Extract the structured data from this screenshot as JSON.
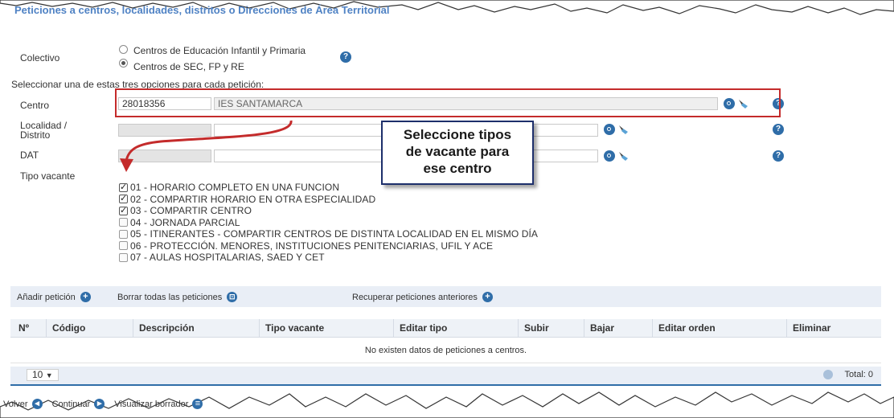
{
  "section": {
    "title": "Peticiones a centros, localidades, distritos o Direcciones de Área Territorial"
  },
  "colectivo": {
    "label": "Colectivo",
    "options": [
      {
        "label": "Centros de Educación Infantil y Primaria",
        "selected": false
      },
      {
        "label": "Centros de SEC, FP y RE",
        "selected": true
      }
    ]
  },
  "instruction": "Seleccionar una de estas tres opciones para cada petición:",
  "centro": {
    "label": "Centro",
    "code": "28018356",
    "name": "IES SANTAMARCA"
  },
  "localidad": {
    "label_line1": "Localidad /",
    "label_line2": "Distrito",
    "code": "",
    "name": ""
  },
  "dat": {
    "label": "DAT",
    "code": "",
    "name": ""
  },
  "callout": {
    "line1": "Seleccione tipos",
    "line2": "de vacante para",
    "line3": "ese centro"
  },
  "tipo_vacante": {
    "label": "Tipo vacante",
    "options": [
      {
        "label": "01 - HORARIO COMPLETO EN UNA FUNCION",
        "checked": true
      },
      {
        "label": "02 - COMPARTIR HORARIO EN OTRA ESPECIALIDAD",
        "checked": true
      },
      {
        "label": "03 - COMPARTIR CENTRO",
        "checked": true
      },
      {
        "label": "04 - JORNADA PARCIAL",
        "checked": false
      },
      {
        "label": "05 - ITINERANTES - COMPARTIR CENTROS DE DISTINTA LOCALIDAD EN EL MISMO DÍA",
        "checked": false
      },
      {
        "label": "06 - PROTECCIÓN. MENORES, INSTITUCIONES PENITENCIARIAS, UFIL Y ACE",
        "checked": false
      },
      {
        "label": "07 - AULAS HOSPITALARIAS, SAED Y CET",
        "checked": false
      }
    ]
  },
  "actions": {
    "add": "Añadir petición",
    "delete_all": "Borrar todas las peticiones",
    "recover": "Recuperar peticiones anteriores"
  },
  "table": {
    "columns": [
      "Nº",
      "Código",
      "Descripción",
      "Tipo vacante",
      "Editar tipo",
      "Subir",
      "Bajar",
      "Editar orden",
      "Eliminar"
    ],
    "empty_message": "No existen datos de peticiones a centros."
  },
  "pager": {
    "page_size": "10",
    "total": "Total: 0"
  },
  "footer": {
    "back": "Volver",
    "continue": "Continuar",
    "view": "Visualizar borrador"
  },
  "colors": {
    "accent": "#2f6da8",
    "title": "#4f82c4",
    "highlight": "#c42b2b",
    "callout_border": "#1d2f6b"
  }
}
